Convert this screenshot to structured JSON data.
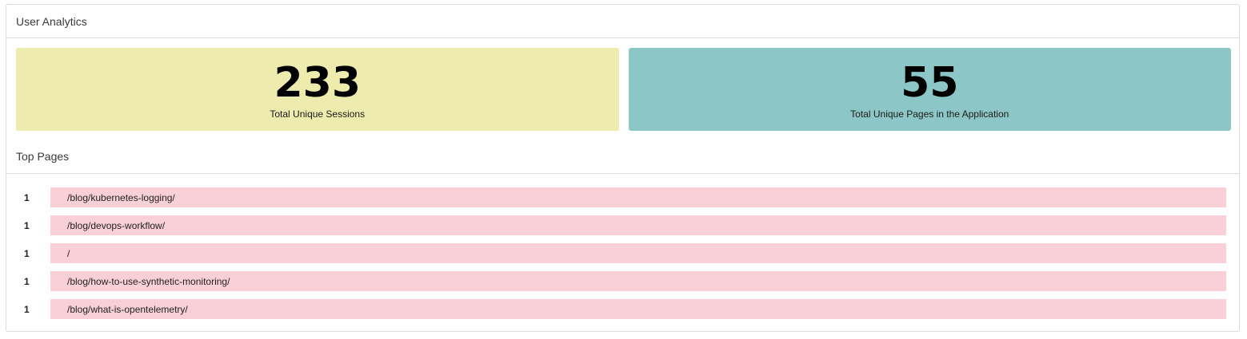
{
  "panel": {
    "title": "User Analytics"
  },
  "stats": [
    {
      "value": "233",
      "label": "Total Unique Sessions",
      "color": "#edebad"
    },
    {
      "value": "55",
      "label": "Total Unique Pages in the Application",
      "color": "#8cc6c7"
    }
  ],
  "top_pages": {
    "title": "Top Pages",
    "bar_color": "#f9d0d8",
    "rows": [
      {
        "count": "1",
        "path": "/blog/kubernetes-logging/",
        "fill": 1.0
      },
      {
        "count": "1",
        "path": "/blog/devops-workflow/",
        "fill": 1.0
      },
      {
        "count": "1",
        "path": "/",
        "fill": 1.0
      },
      {
        "count": "1",
        "path": "/blog/how-to-use-synthetic-monitoring/",
        "fill": 1.0
      },
      {
        "count": "1",
        "path": "/blog/what-is-opentelemetry/",
        "fill": 1.0
      }
    ]
  }
}
